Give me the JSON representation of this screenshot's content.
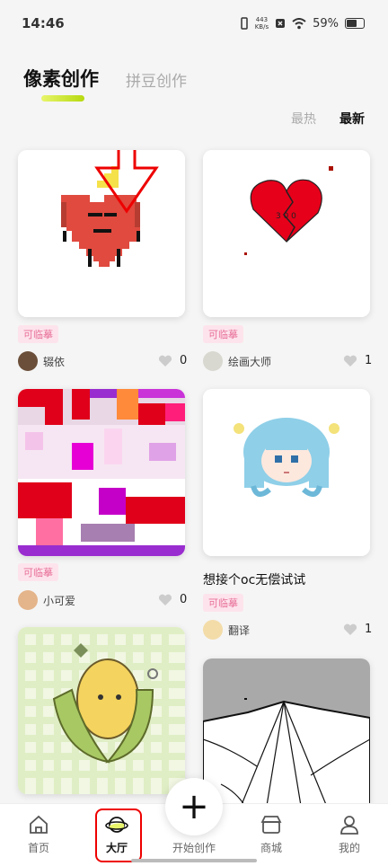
{
  "status_bar": {
    "time": "14:46",
    "net_speed_top": "443",
    "net_speed_bottom": "KB/s",
    "battery": "59%"
  },
  "tabs": [
    {
      "label": "像素创作",
      "active": true
    },
    {
      "label": "拼豆创作",
      "active": false
    }
  ],
  "sort": {
    "hot": "最热",
    "new": "最新"
  },
  "cards": [
    {
      "tag": "可临摹",
      "user": "辍依",
      "likes": "0"
    },
    {
      "tag": "可临摹",
      "user": "绘画大师",
      "likes": "1"
    },
    {
      "tag": "可临摹",
      "user": "小可爱",
      "likes": "0"
    },
    {
      "title": "想接个oc无偿试试",
      "tag": "可临摹",
      "user": "翻译",
      "likes": "1"
    }
  ],
  "heart_text": "3 0 0",
  "nav": [
    {
      "label": "首页",
      "icon": "home-icon"
    },
    {
      "label": "大厅",
      "icon": "planet-icon"
    },
    {
      "label": "开始创作",
      "icon": "plus-icon"
    },
    {
      "label": "商城",
      "icon": "shop-icon"
    },
    {
      "label": "我的",
      "icon": "profile-icon"
    }
  ],
  "plus_symbol": "+",
  "colors": {
    "accent": "#b6d90f",
    "tag_text": "#e86f99",
    "tag_bg": "#fde4ec",
    "annotation": "#e00000"
  }
}
